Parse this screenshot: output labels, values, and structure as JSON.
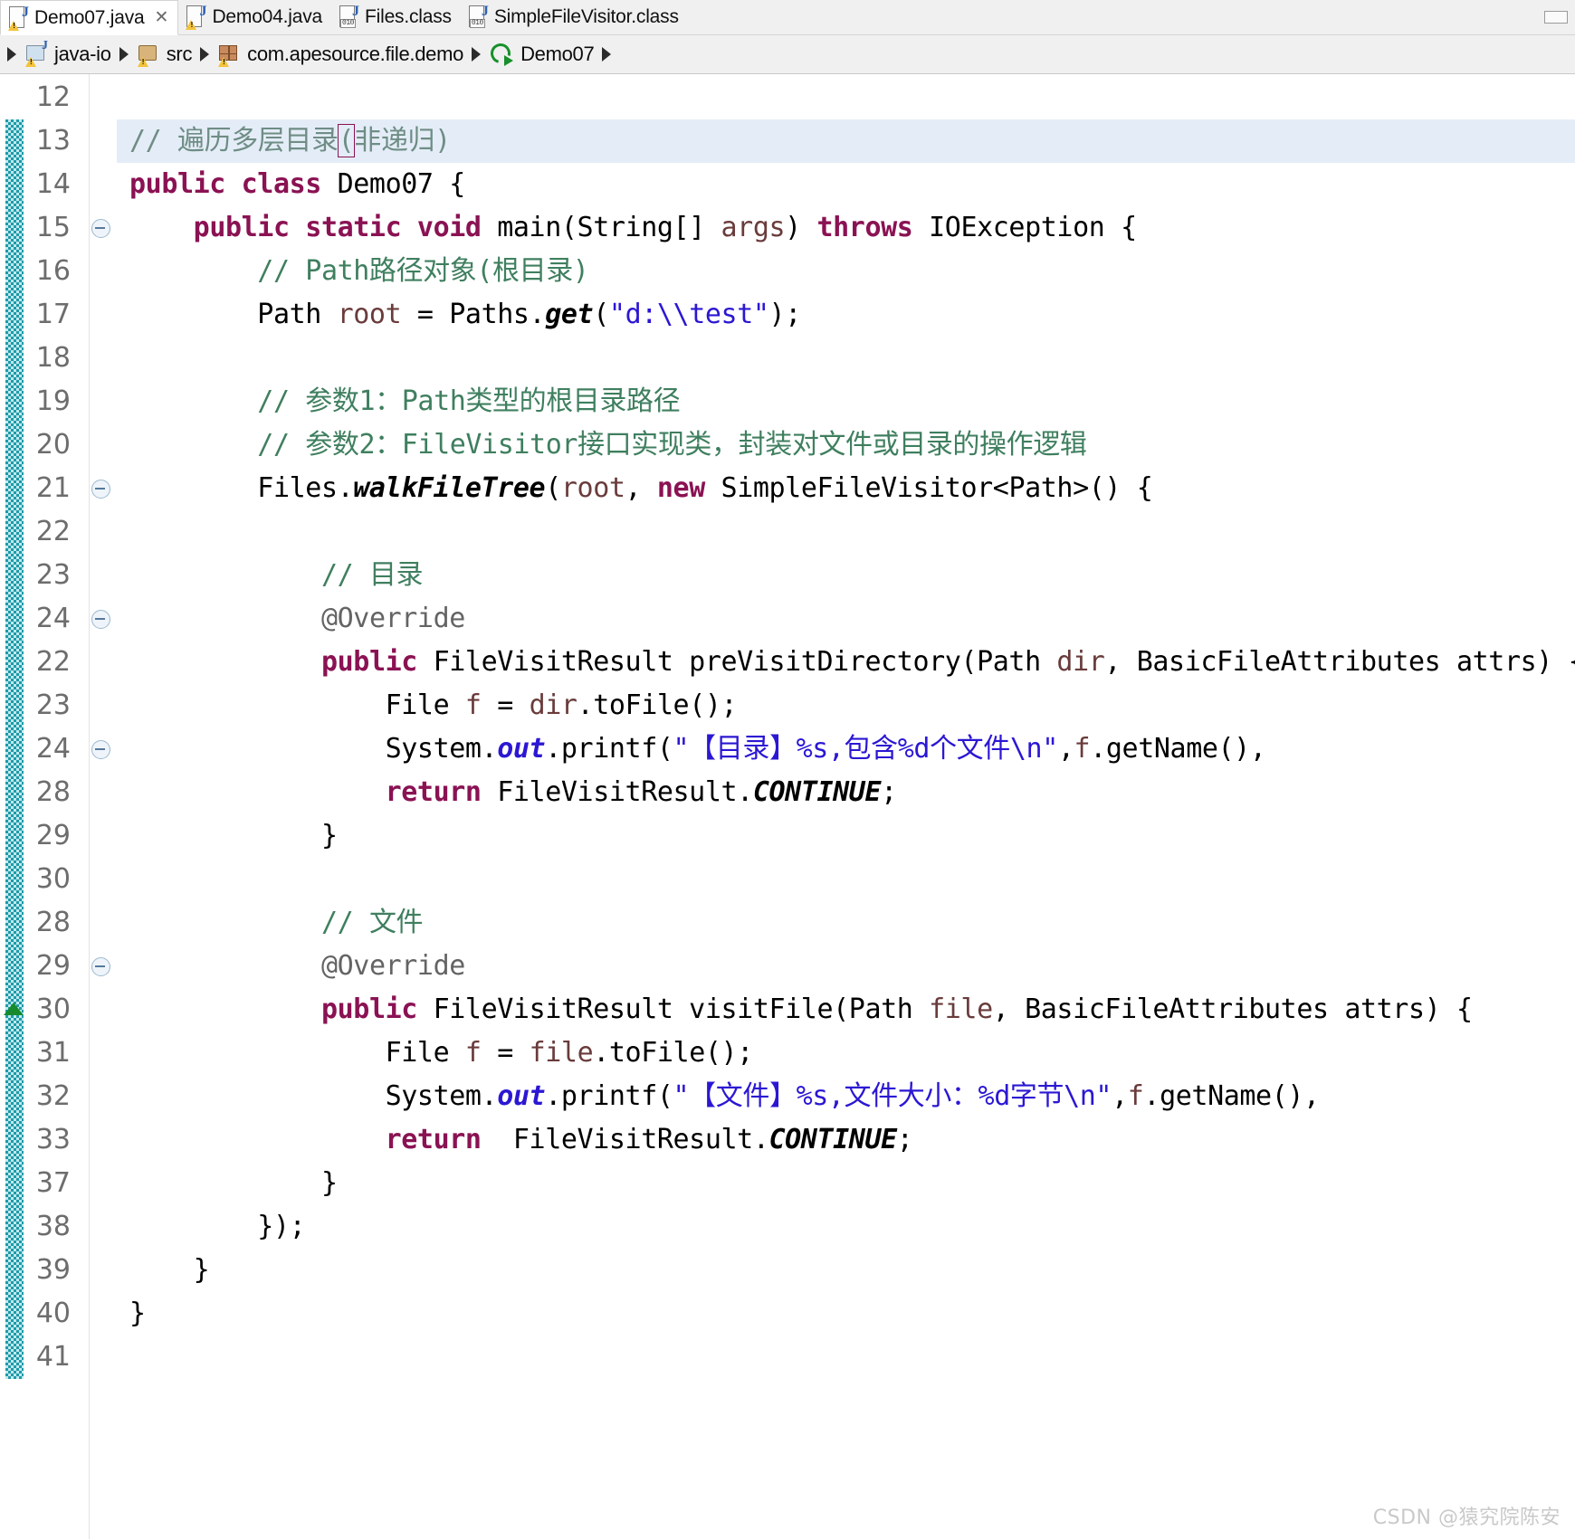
{
  "tabs": [
    {
      "label": "Demo07.java",
      "icon": "java-source-icon",
      "active": true,
      "close": "✕"
    },
    {
      "label": "Demo04.java",
      "icon": "java-source-icon",
      "active": false
    },
    {
      "label": "Files.class",
      "icon": "java-class-icon",
      "active": false
    },
    {
      "label": "SimpleFileVisitor.class",
      "icon": "java-class-icon",
      "active": false
    }
  ],
  "breadcrumb": [
    {
      "label": "java-io",
      "icon": "java-project-icon"
    },
    {
      "label": "src",
      "icon": "source-folder-icon"
    },
    {
      "label": "com.apesource.file.demo",
      "icon": "package-icon"
    },
    {
      "label": "Demo07",
      "icon": "run-class-icon"
    }
  ],
  "editor": {
    "file": "Demo07.java",
    "colors": {
      "keyword": "#8a1253",
      "comment": "#3f7f5f",
      "string": "#2b17d3",
      "field": "#6a3b3b",
      "annotation": "#646464",
      "highlight_line": "#e4edf7",
      "changebar": "#1f9aa8",
      "gutter_text": "#6d6d6d"
    },
    "lines": [
      {
        "num": "12",
        "fold": false,
        "highlight": false,
        "tokens": []
      },
      {
        "num": "13",
        "fold": false,
        "highlight": true,
        "tokens": [
          {
            "t": "// ",
            "c": "cm-hl"
          },
          {
            "t": "遍历多层目录",
            "c": "cm-hl"
          },
          {
            "t": "(",
            "c": "cm-hl brk"
          },
          {
            "t": "非递归)",
            "c": "cm-hl"
          }
        ]
      },
      {
        "num": "14",
        "fold": false,
        "highlight": false,
        "tokens": [
          {
            "t": "public class ",
            "c": "kw"
          },
          {
            "t": "Demo07 {",
            "c": ""
          }
        ]
      },
      {
        "num": "15",
        "fold": true,
        "highlight": false,
        "tokens": [
          {
            "t": "    ",
            "c": ""
          },
          {
            "t": "public static void ",
            "c": "kw"
          },
          {
            "t": "main(String[] ",
            "c": ""
          },
          {
            "t": "args",
            "c": "fld"
          },
          {
            "t": ") ",
            "c": ""
          },
          {
            "t": "throws ",
            "c": "kw"
          },
          {
            "t": "IOException {",
            "c": ""
          }
        ]
      },
      {
        "num": "16",
        "fold": false,
        "highlight": false,
        "tokens": [
          {
            "t": "        ",
            "c": ""
          },
          {
            "t": "// Path路径对象(根目录)",
            "c": "cm"
          }
        ]
      },
      {
        "num": "17",
        "fold": false,
        "highlight": false,
        "tokens": [
          {
            "t": "        Path ",
            "c": ""
          },
          {
            "t": "root",
            "c": "fld"
          },
          {
            "t": " = Paths.",
            "c": ""
          },
          {
            "t": "get",
            "c": "mth"
          },
          {
            "t": "(",
            "c": ""
          },
          {
            "t": "\"d:\\\\test\"",
            "c": "str"
          },
          {
            "t": ");",
            "c": ""
          }
        ]
      },
      {
        "num": "18",
        "fold": false,
        "highlight": false,
        "tokens": []
      },
      {
        "num": "19",
        "fold": false,
        "highlight": false,
        "tokens": [
          {
            "t": "        ",
            "c": ""
          },
          {
            "t": "// 参数1：Path类型的根目录路径",
            "c": "cm"
          }
        ]
      },
      {
        "num": "20",
        "fold": false,
        "highlight": false,
        "tokens": [
          {
            "t": "        ",
            "c": ""
          },
          {
            "t": "// 参数2：FileVisitor接口实现类，封装对文件或目录的操作逻辑",
            "c": "cm"
          }
        ]
      },
      {
        "num": "21",
        "fold": true,
        "highlight": false,
        "tokens": [
          {
            "t": "        Files.",
            "c": ""
          },
          {
            "t": "walkFileTree",
            "c": "mth"
          },
          {
            "t": "(",
            "c": ""
          },
          {
            "t": "root",
            "c": "fld"
          },
          {
            "t": ", ",
            "c": ""
          },
          {
            "t": "new ",
            "c": "kw"
          },
          {
            "t": "SimpleFileVisitor<Path>() {",
            "c": ""
          }
        ]
      },
      {
        "num": "22",
        "fold": false,
        "highlight": false,
        "tokens": []
      },
      {
        "num": "23",
        "fold": false,
        "highlight": false,
        "tokens": [
          {
            "t": "            ",
            "c": ""
          },
          {
            "t": "// 目录",
            "c": "cm"
          }
        ]
      },
      {
        "num": "24",
        "fold": true,
        "highlight": false,
        "tokens": [
          {
            "t": "            ",
            "c": ""
          },
          {
            "t": "@Override",
            "c": "ann"
          }
        ]
      },
      {
        "num": "22",
        "fold": false,
        "highlight": false,
        "tokens": [
          {
            "t": "            ",
            "c": ""
          },
          {
            "t": "public ",
            "c": "kw"
          },
          {
            "t": "FileVisitResult preVisitDirectory(Path ",
            "c": ""
          },
          {
            "t": "dir",
            "c": "fld"
          },
          {
            "t": ", BasicFileAttributes attrs) {",
            "c": ""
          }
        ]
      },
      {
        "num": "23",
        "fold": false,
        "highlight": false,
        "tokens": [
          {
            "t": "                File ",
            "c": ""
          },
          {
            "t": "f",
            "c": "fld"
          },
          {
            "t": " = ",
            "c": ""
          },
          {
            "t": "dir",
            "c": "fld"
          },
          {
            "t": ".toFile();",
            "c": ""
          }
        ]
      },
      {
        "num": "24",
        "fold": true,
        "highlight": false,
        "tokens": [
          {
            "t": "                System.",
            "c": ""
          },
          {
            "t": "out",
            "c": "stf"
          },
          {
            "t": ".printf(",
            "c": ""
          },
          {
            "t": "\"【目录】%s,包含%d个文件\\n\"",
            "c": "str"
          },
          {
            "t": ",",
            "c": ""
          },
          {
            "t": "f",
            "c": "fld"
          },
          {
            "t": ".getName(),",
            "c": ""
          }
        ]
      },
      {
        "num": "28",
        "fold": false,
        "highlight": false,
        "tokens": [
          {
            "t": "                ",
            "c": ""
          },
          {
            "t": "return ",
            "c": "kw"
          },
          {
            "t": "FileVisitResult.",
            "c": ""
          },
          {
            "t": "CONTINUE",
            "c": "consti"
          },
          {
            "t": ";",
            "c": ""
          }
        ]
      },
      {
        "num": "29",
        "fold": false,
        "highlight": false,
        "tokens": [
          {
            "t": "            }",
            "c": ""
          }
        ]
      },
      {
        "num": "30",
        "fold": false,
        "highlight": false,
        "tokens": []
      },
      {
        "num": "28",
        "fold": false,
        "highlight": false,
        "tokens": [
          {
            "t": "            ",
            "c": ""
          },
          {
            "t": "// 文件",
            "c": "cm"
          }
        ]
      },
      {
        "num": "29",
        "fold": true,
        "highlight": false,
        "tokens": [
          {
            "t": "            ",
            "c": ""
          },
          {
            "t": "@Override",
            "c": "ann"
          }
        ]
      },
      {
        "num": "30",
        "fold": false,
        "highlight": false,
        "marker": "up-arrow",
        "tokens": [
          {
            "t": "            ",
            "c": ""
          },
          {
            "t": "public ",
            "c": "kw"
          },
          {
            "t": "FileVisitResult visitFile(Path ",
            "c": ""
          },
          {
            "t": "file",
            "c": "fld"
          },
          {
            "t": ", BasicFileAttributes attrs) {",
            "c": ""
          }
        ]
      },
      {
        "num": "31",
        "fold": false,
        "highlight": false,
        "tokens": [
          {
            "t": "                File ",
            "c": ""
          },
          {
            "t": "f",
            "c": "fld"
          },
          {
            "t": " = ",
            "c": ""
          },
          {
            "t": "file",
            "c": "fld"
          },
          {
            "t": ".toFile();",
            "c": ""
          }
        ]
      },
      {
        "num": "32",
        "fold": false,
        "highlight": false,
        "tokens": [
          {
            "t": "                System.",
            "c": ""
          },
          {
            "t": "out",
            "c": "stf"
          },
          {
            "t": ".printf(",
            "c": ""
          },
          {
            "t": "\"【文件】%s,文件大小：%d字节\\n\"",
            "c": "str"
          },
          {
            "t": ",",
            "c": ""
          },
          {
            "t": "f",
            "c": "fld"
          },
          {
            "t": ".getName(),",
            "c": ""
          }
        ]
      },
      {
        "num": "33",
        "fold": false,
        "highlight": false,
        "tokens": [
          {
            "t": "                ",
            "c": ""
          },
          {
            "t": "return ",
            "c": "kw"
          },
          {
            "t": " FileVisitResult.",
            "c": ""
          },
          {
            "t": "CONTINUE",
            "c": "consti"
          },
          {
            "t": ";",
            "c": ""
          }
        ]
      },
      {
        "num": "37",
        "fold": false,
        "highlight": false,
        "tokens": [
          {
            "t": "            }",
            "c": ""
          }
        ]
      },
      {
        "num": "38",
        "fold": false,
        "highlight": false,
        "tokens": [
          {
            "t": "        });",
            "c": ""
          }
        ]
      },
      {
        "num": "39",
        "fold": false,
        "highlight": false,
        "tokens": [
          {
            "t": "    }",
            "c": ""
          }
        ]
      },
      {
        "num": "40",
        "fold": false,
        "highlight": false,
        "tokens": [
          {
            "t": "}",
            "c": ""
          }
        ]
      },
      {
        "num": "41",
        "fold": false,
        "highlight": false,
        "tokens": []
      }
    ]
  },
  "watermark": "CSDN @猿究院陈安"
}
